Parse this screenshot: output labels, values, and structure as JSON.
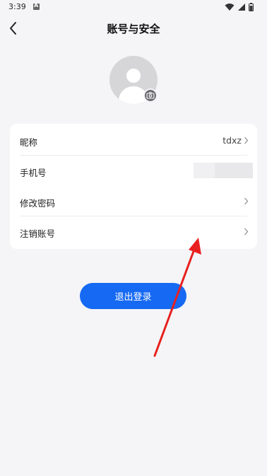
{
  "status_bar": {
    "time": "3:39",
    "icons": [
      "a-notification-icon",
      "wifi-icon",
      "signal-icon",
      "battery-icon"
    ]
  },
  "header": {
    "back_icon": "chevron-left-icon",
    "title": "账号与安全"
  },
  "avatar": {
    "icon": "default-avatar-icon",
    "badge_icon": "camera-icon"
  },
  "settings": {
    "items": [
      {
        "label": "昵称",
        "value": "tdxz",
        "icon": "chevron-right-icon"
      },
      {
        "label": "手机号",
        "value": "",
        "icon": ""
      },
      {
        "label": "修改密码",
        "value": "",
        "icon": "chevron-right-icon"
      },
      {
        "label": "注销账号",
        "value": "",
        "icon": "chevron-right-icon"
      }
    ]
  },
  "logout": {
    "label": "退出登录"
  },
  "colors": {
    "background": "#f5f5f8",
    "accent": "#1669f2",
    "card": "#ffffff",
    "annotation": "#e8201f"
  }
}
